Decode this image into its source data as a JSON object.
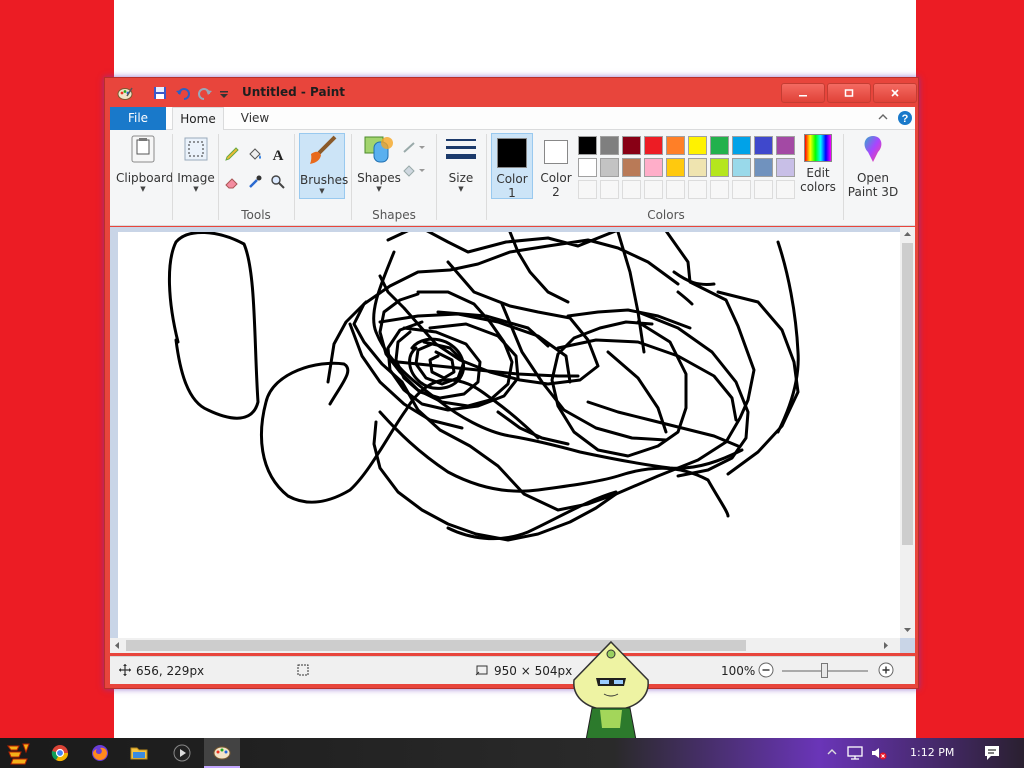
{
  "window": {
    "title": "Untitled - Paint"
  },
  "tabs": {
    "file": "File",
    "home": "Home",
    "view": "View"
  },
  "ribbon": {
    "clipboard": "Clipboard",
    "image": "Image",
    "tools_group": "Tools",
    "brushes": "Brushes",
    "shapes": "Shapes",
    "shapes_group": "Shapes",
    "size": "Size",
    "color1_line1": "Color",
    "color1_line2": "1",
    "color2_line1": "Color",
    "color2_line2": "2",
    "colors_group": "Colors",
    "edit_colors_line1": "Edit",
    "edit_colors_line2": "colors",
    "open3d_line1": "Open",
    "open3d_line2": "Paint 3D"
  },
  "colors": {
    "color1": "#000000",
    "color2": "#ffffff",
    "palette_row1": [
      "#000000",
      "#7f7f7f",
      "#880015",
      "#ed1c24",
      "#ff7f27",
      "#fff200",
      "#22b14c",
      "#00a2e8",
      "#3f48cc",
      "#a349a4"
    ],
    "palette_row2": [
      "#ffffff",
      "#c3c3c3",
      "#b97a57",
      "#ffaec9",
      "#ffc90e",
      "#efe4b0",
      "#b5e61d",
      "#99d9ea",
      "#7092be",
      "#c8bfe7"
    ]
  },
  "status": {
    "cursor_pos": "656, 229px",
    "canvas_size": "950 × 504px",
    "zoom": "100%"
  },
  "taskbar": {
    "time": "1:12 PM"
  }
}
